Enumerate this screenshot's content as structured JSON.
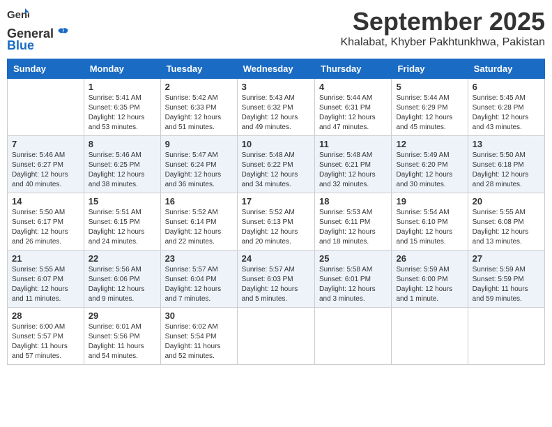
{
  "header": {
    "logo_general": "General",
    "logo_blue": "Blue",
    "month_title": "September 2025",
    "location": "Khalabat, Khyber Pakhtunkhwa, Pakistan"
  },
  "columns": [
    "Sunday",
    "Monday",
    "Tuesday",
    "Wednesday",
    "Thursday",
    "Friday",
    "Saturday"
  ],
  "weeks": [
    [
      {
        "day": "",
        "info": ""
      },
      {
        "day": "1",
        "info": "Sunrise: 5:41 AM\nSunset: 6:35 PM\nDaylight: 12 hours\nand 53 minutes."
      },
      {
        "day": "2",
        "info": "Sunrise: 5:42 AM\nSunset: 6:33 PM\nDaylight: 12 hours\nand 51 minutes."
      },
      {
        "day": "3",
        "info": "Sunrise: 5:43 AM\nSunset: 6:32 PM\nDaylight: 12 hours\nand 49 minutes."
      },
      {
        "day": "4",
        "info": "Sunrise: 5:44 AM\nSunset: 6:31 PM\nDaylight: 12 hours\nand 47 minutes."
      },
      {
        "day": "5",
        "info": "Sunrise: 5:44 AM\nSunset: 6:29 PM\nDaylight: 12 hours\nand 45 minutes."
      },
      {
        "day": "6",
        "info": "Sunrise: 5:45 AM\nSunset: 6:28 PM\nDaylight: 12 hours\nand 43 minutes."
      }
    ],
    [
      {
        "day": "7",
        "info": "Sunrise: 5:46 AM\nSunset: 6:27 PM\nDaylight: 12 hours\nand 40 minutes."
      },
      {
        "day": "8",
        "info": "Sunrise: 5:46 AM\nSunset: 6:25 PM\nDaylight: 12 hours\nand 38 minutes."
      },
      {
        "day": "9",
        "info": "Sunrise: 5:47 AM\nSunset: 6:24 PM\nDaylight: 12 hours\nand 36 minutes."
      },
      {
        "day": "10",
        "info": "Sunrise: 5:48 AM\nSunset: 6:22 PM\nDaylight: 12 hours\nand 34 minutes."
      },
      {
        "day": "11",
        "info": "Sunrise: 5:48 AM\nSunset: 6:21 PM\nDaylight: 12 hours\nand 32 minutes."
      },
      {
        "day": "12",
        "info": "Sunrise: 5:49 AM\nSunset: 6:20 PM\nDaylight: 12 hours\nand 30 minutes."
      },
      {
        "day": "13",
        "info": "Sunrise: 5:50 AM\nSunset: 6:18 PM\nDaylight: 12 hours\nand 28 minutes."
      }
    ],
    [
      {
        "day": "14",
        "info": "Sunrise: 5:50 AM\nSunset: 6:17 PM\nDaylight: 12 hours\nand 26 minutes."
      },
      {
        "day": "15",
        "info": "Sunrise: 5:51 AM\nSunset: 6:15 PM\nDaylight: 12 hours\nand 24 minutes."
      },
      {
        "day": "16",
        "info": "Sunrise: 5:52 AM\nSunset: 6:14 PM\nDaylight: 12 hours\nand 22 minutes."
      },
      {
        "day": "17",
        "info": "Sunrise: 5:52 AM\nSunset: 6:13 PM\nDaylight: 12 hours\nand 20 minutes."
      },
      {
        "day": "18",
        "info": "Sunrise: 5:53 AM\nSunset: 6:11 PM\nDaylight: 12 hours\nand 18 minutes."
      },
      {
        "day": "19",
        "info": "Sunrise: 5:54 AM\nSunset: 6:10 PM\nDaylight: 12 hours\nand 15 minutes."
      },
      {
        "day": "20",
        "info": "Sunrise: 5:55 AM\nSunset: 6:08 PM\nDaylight: 12 hours\nand 13 minutes."
      }
    ],
    [
      {
        "day": "21",
        "info": "Sunrise: 5:55 AM\nSunset: 6:07 PM\nDaylight: 12 hours\nand 11 minutes."
      },
      {
        "day": "22",
        "info": "Sunrise: 5:56 AM\nSunset: 6:06 PM\nDaylight: 12 hours\nand 9 minutes."
      },
      {
        "day": "23",
        "info": "Sunrise: 5:57 AM\nSunset: 6:04 PM\nDaylight: 12 hours\nand 7 minutes."
      },
      {
        "day": "24",
        "info": "Sunrise: 5:57 AM\nSunset: 6:03 PM\nDaylight: 12 hours\nand 5 minutes."
      },
      {
        "day": "25",
        "info": "Sunrise: 5:58 AM\nSunset: 6:01 PM\nDaylight: 12 hours\nand 3 minutes."
      },
      {
        "day": "26",
        "info": "Sunrise: 5:59 AM\nSunset: 6:00 PM\nDaylight: 12 hours\nand 1 minute."
      },
      {
        "day": "27",
        "info": "Sunrise: 5:59 AM\nSunset: 5:59 PM\nDaylight: 11 hours\nand 59 minutes."
      }
    ],
    [
      {
        "day": "28",
        "info": "Sunrise: 6:00 AM\nSunset: 5:57 PM\nDaylight: 11 hours\nand 57 minutes."
      },
      {
        "day": "29",
        "info": "Sunrise: 6:01 AM\nSunset: 5:56 PM\nDaylight: 11 hours\nand 54 minutes."
      },
      {
        "day": "30",
        "info": "Sunrise: 6:02 AM\nSunset: 5:54 PM\nDaylight: 11 hours\nand 52 minutes."
      },
      {
        "day": "",
        "info": ""
      },
      {
        "day": "",
        "info": ""
      },
      {
        "day": "",
        "info": ""
      },
      {
        "day": "",
        "info": ""
      }
    ]
  ]
}
